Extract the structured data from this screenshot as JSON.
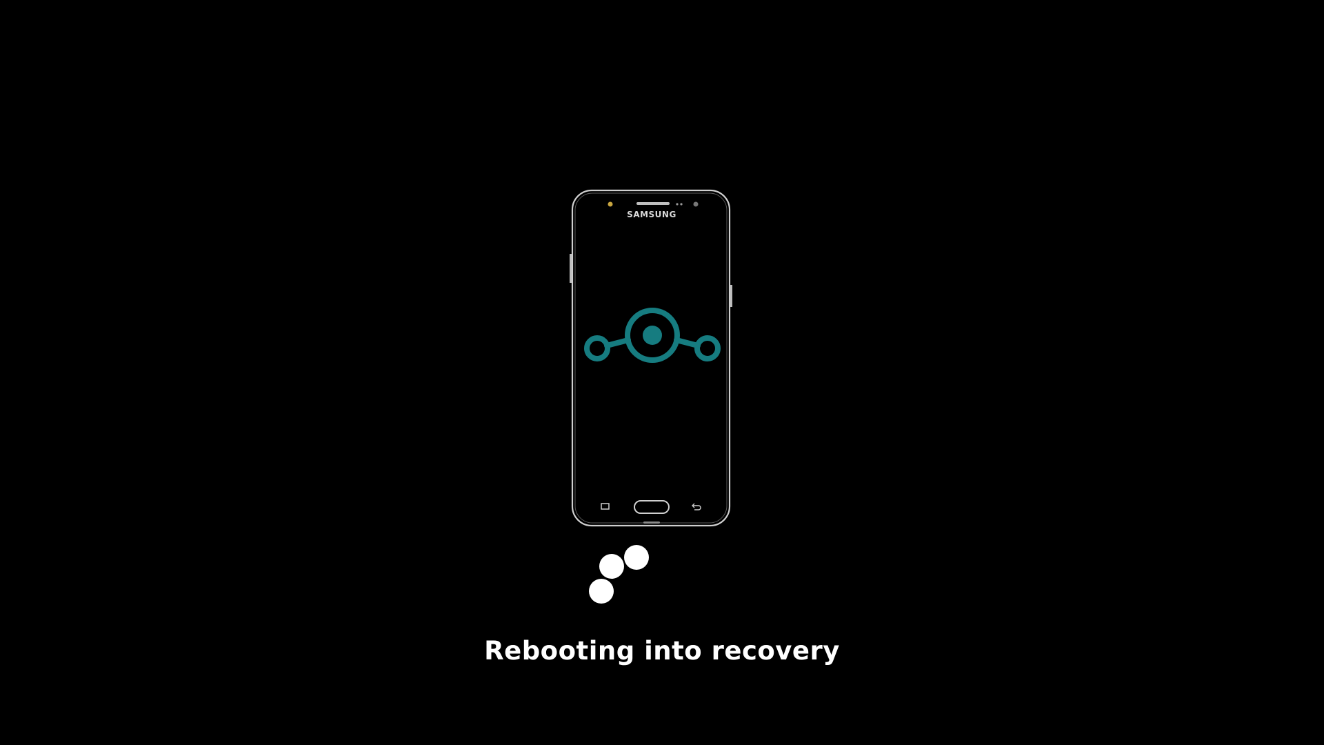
{
  "device": {
    "brand": "SAMSUNG"
  },
  "logo": {
    "icon": "lineageos-logo-icon",
    "color": "#167c80"
  },
  "spinner": {
    "icon": "loading-dots-icon",
    "color": "#ffffff"
  },
  "status": {
    "message": "Rebooting into recovery"
  }
}
